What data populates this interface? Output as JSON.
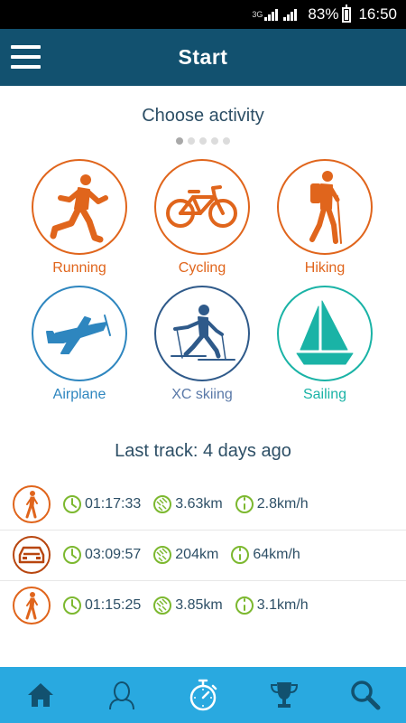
{
  "status_bar": {
    "network": "3G",
    "battery": "83%",
    "time": "16:50"
  },
  "header": {
    "title": "Start",
    "menu_icon": "hamburger-menu-icon"
  },
  "activities": {
    "title": "Choose activity",
    "page_count": 5,
    "active_page": 1,
    "items": [
      {
        "label": "Running",
        "icon": "running-icon",
        "color": "#e0651c"
      },
      {
        "label": "Cycling",
        "icon": "bicycle-icon",
        "color": "#e0651c"
      },
      {
        "label": "Hiking",
        "icon": "hiking-icon",
        "color": "#e0651c"
      },
      {
        "label": "Airplane",
        "icon": "airplane-icon",
        "color": "#2e86bf"
      },
      {
        "label": "XC skiing",
        "icon": "xc-skiing-icon",
        "color": "#2f5a8a"
      },
      {
        "label": "Sailing",
        "icon": "sailboat-icon",
        "color": "#1ab3a6"
      }
    ]
  },
  "last_track": {
    "title": "Last track: 4 days ago",
    "tracks": [
      {
        "type_icon": "walking-icon",
        "duration": "01:17:33",
        "distance": "3.63km",
        "speed": "2.8km/h"
      },
      {
        "type_icon": "car-icon",
        "duration": "03:09:57",
        "distance": "204km",
        "speed": "64km/h"
      },
      {
        "type_icon": "walking-icon",
        "duration": "01:15:25",
        "distance": "3.85km",
        "speed": "3.1km/h"
      }
    ]
  },
  "bottom_nav": {
    "items": [
      {
        "icon": "home-icon"
      },
      {
        "icon": "profile-icon"
      },
      {
        "icon": "stopwatch-icon"
      },
      {
        "icon": "trophy-icon"
      },
      {
        "icon": "search-icon"
      }
    ]
  },
  "colors": {
    "app_bar": "#12516f",
    "bottom_nav": "#29a9e0",
    "orange": "#e0651c",
    "metric_green": "#7cb82f"
  }
}
